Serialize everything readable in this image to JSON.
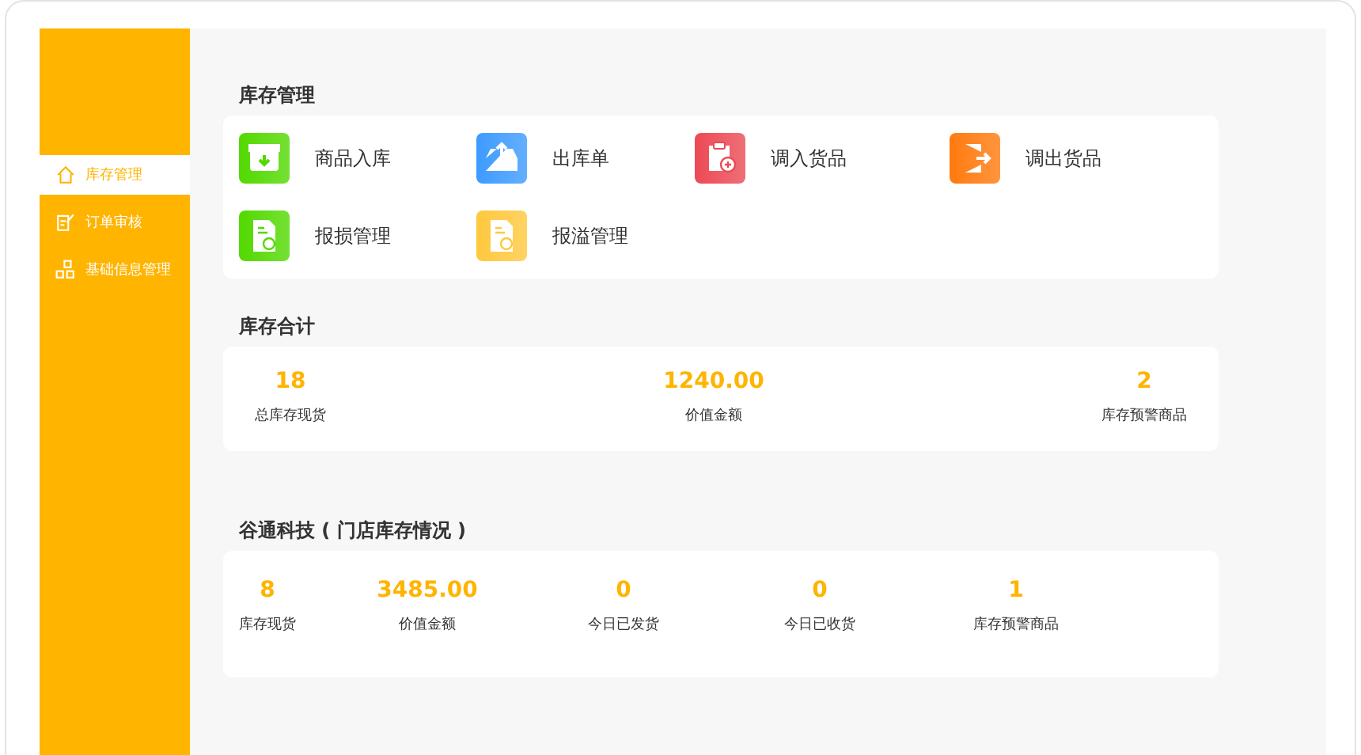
{
  "sidebar": {
    "items": [
      {
        "label": "库存管理",
        "kind": "house",
        "selected": true
      },
      {
        "label": "订单审核",
        "kind": "edit",
        "selected": false
      },
      {
        "label": "基础信息管理",
        "kind": "blocks",
        "selected": false
      }
    ]
  },
  "inventory_management": {
    "title": "库存管理",
    "actions": [
      {
        "label": "商品入库",
        "kind": "inbound",
        "color": "#52d900"
      },
      {
        "label": "出库单",
        "kind": "outbound",
        "color": "#3d9bff"
      },
      {
        "label": "调入货品",
        "kind": "transferin",
        "color": "#ec4a55"
      },
      {
        "label": "调出货品",
        "kind": "transferout",
        "color": "#ff7a0f"
      },
      {
        "label": "报损管理",
        "kind": "report",
        "color": "#52d900"
      },
      {
        "label": "报溢管理",
        "kind": "report",
        "color": "#ffc83d"
      }
    ]
  },
  "inventory_total": {
    "title": "库存合计",
    "stats": [
      {
        "value": "18",
        "label": "总库存现货"
      },
      {
        "value": "1240.00",
        "label": "价值金额"
      },
      {
        "value": "2",
        "label": "库存预警商品"
      }
    ]
  },
  "store_inventory": {
    "title": "谷通科技 ( 门店库存情况 )",
    "stats": [
      {
        "value": "8",
        "label": "库存现货"
      },
      {
        "value": "3485.00",
        "label": "价值金额"
      },
      {
        "value": "0",
        "label": "今日已发货"
      },
      {
        "value": "0",
        "label": "今日已收货"
      },
      {
        "value": "1",
        "label": "库存预警商品"
      }
    ]
  }
}
